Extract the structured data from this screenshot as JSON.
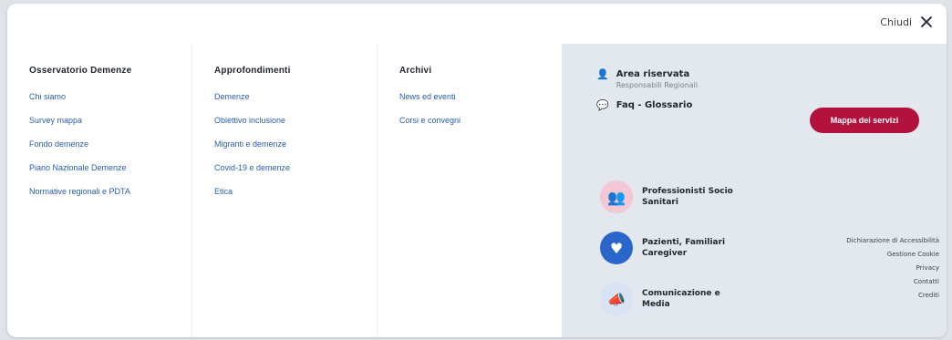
{
  "header": {
    "close_label": "Chiudi"
  },
  "columns": [
    {
      "title": "Osservatorio Demenze",
      "links": [
        "Chi siamo",
        "Survey mappa",
        "Fondo demenze",
        "Piano Nazionale Demenze",
        "Normative regionali e PDTA"
      ]
    },
    {
      "title": "Approfondimenti",
      "links": [
        "Demenze",
        "Obiettivo inclusione",
        "Migranti e demenze",
        "Covid-19 e demenze",
        "Etica"
      ]
    },
    {
      "title": "Archivi",
      "links": [
        "News ed eventi",
        "Corsi e convegni"
      ]
    }
  ],
  "side": {
    "reserved": {
      "icon": "user-icon",
      "title": "Area riservata",
      "subtitle": "Responsabili Regionali"
    },
    "faq": {
      "icon": "chat-icon",
      "title": "Faq - Glossario"
    },
    "cta": "Mappa dei servizi",
    "targets": [
      {
        "icon": "professionals-icon",
        "label_line1": "Professionisti Socio",
        "label_line2": "Sanitari"
      },
      {
        "icon": "patients-icon",
        "label_line1": "Pazienti, Familiari",
        "label_line2": "Caregiver"
      },
      {
        "icon": "megaphone-icon",
        "label_line1": "Comunicazione e",
        "label_line2": "Media"
      }
    ],
    "footer_links": [
      "Dichiarazione di Accessibilità",
      "Gestione Cookie",
      "Privacy",
      "Contatti",
      "Crediti"
    ]
  }
}
